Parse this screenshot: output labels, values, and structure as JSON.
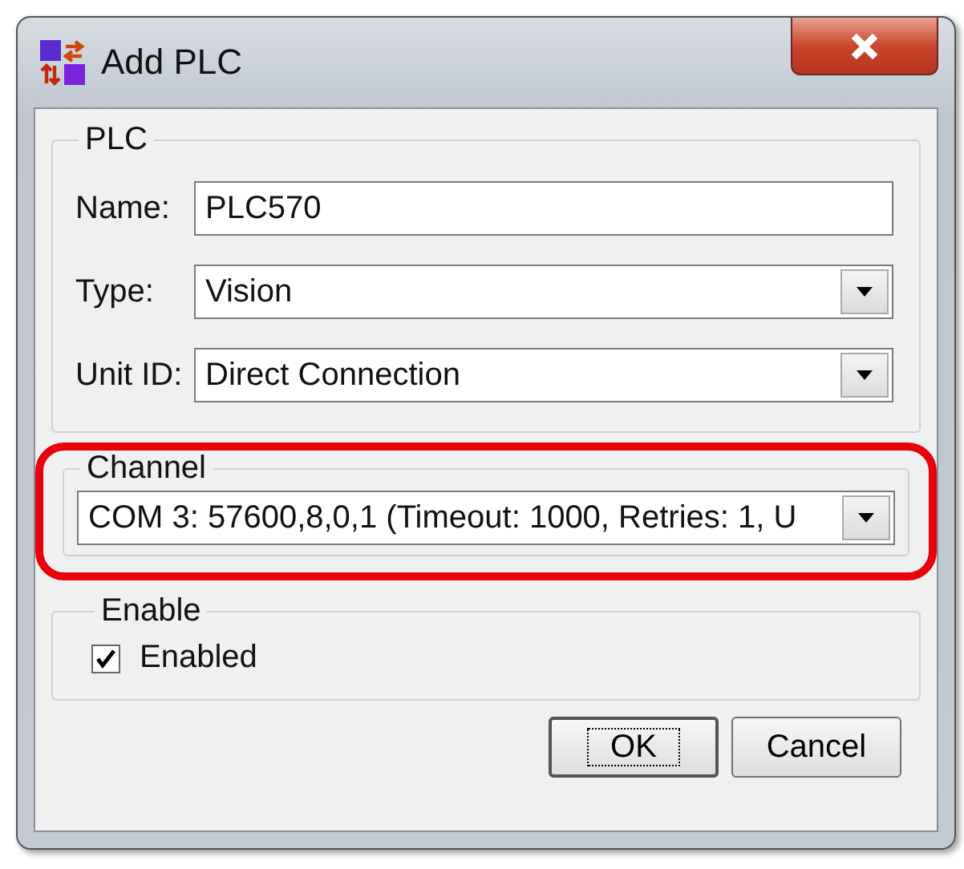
{
  "window": {
    "title": "Add PLC"
  },
  "plc_group": {
    "title": "PLC",
    "fields": [
      {
        "kind": "text",
        "label": "Name:",
        "value": "PLC570"
      },
      {
        "kind": "dropdown",
        "label": "Type:",
        "value": "Vision"
      },
      {
        "kind": "dropdown",
        "label": "Unit ID:",
        "value": "Direct Connection"
      }
    ]
  },
  "channel_group": {
    "title": "Channel",
    "value": "COM 3: 57600,8,0,1 (Timeout: 1000, Retries: 1, U",
    "highlighted": true
  },
  "enable_group": {
    "title": "Enable",
    "checkbox": {
      "label": "Enabled",
      "checked": true
    }
  },
  "buttons": [
    {
      "label": "OK",
      "focused": true
    },
    {
      "label": "Cancel",
      "focused": false
    }
  ]
}
